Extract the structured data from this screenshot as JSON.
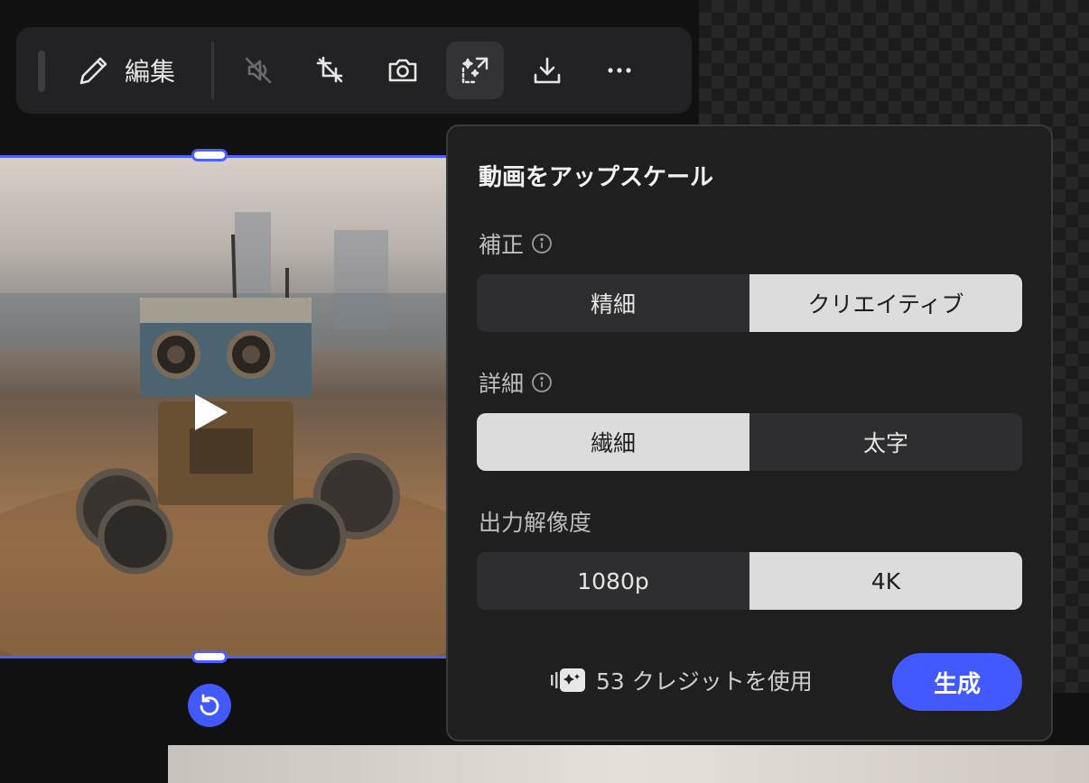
{
  "toolbar": {
    "edit_label": "編集",
    "icons": [
      "pencil-icon",
      "mute-icon",
      "no-crop-icon",
      "camera-icon",
      "upscale-icon",
      "download-icon",
      "more-icon"
    ]
  },
  "upscale_panel": {
    "title": "動画をアップスケール",
    "correction": {
      "label": "補正",
      "options": [
        "精細",
        "クリエイティブ"
      ],
      "selected": "クリエイティブ"
    },
    "detail": {
      "label": "詳細",
      "options": [
        "繊細",
        "太字"
      ],
      "selected": "繊細"
    },
    "resolution": {
      "label": "出力解像度",
      "options": [
        "1080p",
        "4K"
      ],
      "selected": "4K"
    },
    "credits_text": "53 クレジットを使用",
    "generate_label": "生成"
  },
  "colors": {
    "accent": "#4159ff",
    "panel_bg": "#1f1f20",
    "selected_bg": "#dcdcdc"
  }
}
